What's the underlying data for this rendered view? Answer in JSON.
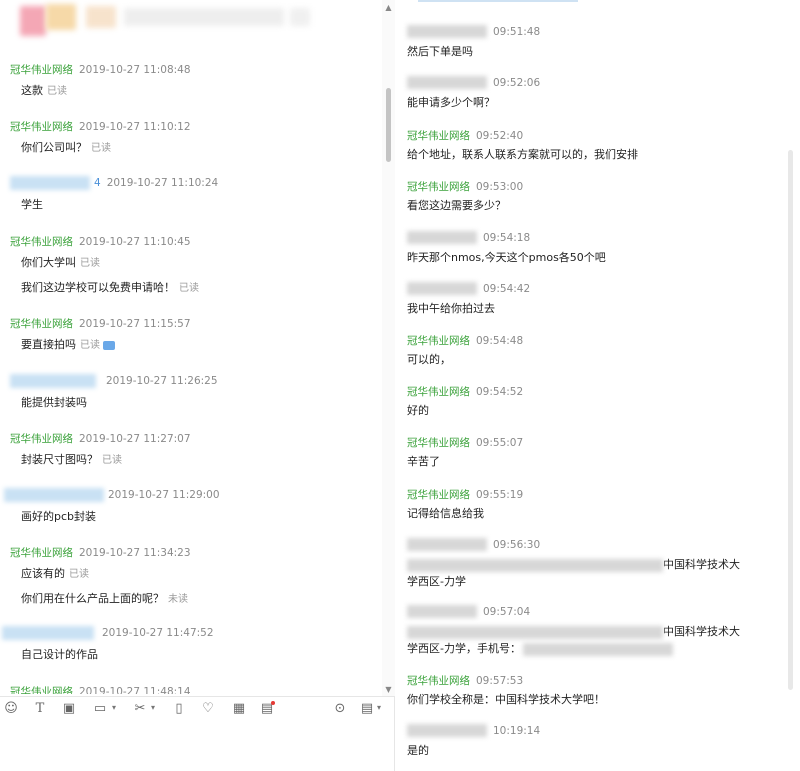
{
  "left": {
    "messages": [
      {
        "sender": "冠华伟业网络",
        "time": "2019-10-27 11:08:48",
        "lines": [
          {
            "text": "这款",
            "status": "已读"
          }
        ]
      },
      {
        "sender": "冠华伟业网络",
        "time": "2019-10-27 11:10:12",
        "lines": [
          {
            "text": "你们公司叫？",
            "status": "已读"
          }
        ]
      },
      {
        "sender": "4",
        "time": "2019-10-27 11:10:24",
        "lines": [
          {
            "text": "学生",
            "status": ""
          }
        ]
      },
      {
        "sender": "冠华伟业网络",
        "time": "2019-10-27 11:10:45",
        "lines": [
          {
            "text": "你们大学叫",
            "status": "已读"
          },
          {
            "text": "我们这边学校可以免费申请哈！",
            "status": "已读"
          }
        ]
      },
      {
        "sender": "冠华伟业网络",
        "time": "2019-10-27 11:15:57",
        "lines": [
          {
            "text": "要直接拍吗",
            "status": "已读"
          }
        ]
      },
      {
        "sender": "",
        "time": "2019-10-27 11:26:25",
        "lines": [
          {
            "text": "能提供封装吗",
            "status": ""
          }
        ]
      },
      {
        "sender": "冠华伟业网络",
        "time": "2019-10-27 11:27:07",
        "lines": [
          {
            "text": "封装尺寸图吗？",
            "status": "已读"
          }
        ]
      },
      {
        "sender": "",
        "time": "2019-10-27 11:29:00",
        "lines": [
          {
            "text": "画好的pcb封装",
            "status": ""
          }
        ]
      },
      {
        "sender": "冠华伟业网络",
        "time": "2019-10-27 11:34:23",
        "lines": [
          {
            "text": "应该有的",
            "status": "已读"
          },
          {
            "text": "你们用在什么产品上面的呢？",
            "status": "未读"
          }
        ]
      },
      {
        "sender": "",
        "time": "2019-10-27 11:47:52",
        "lines": [
          {
            "text": "自己设计的作品",
            "status": ""
          }
        ]
      },
      {
        "sender": "冠华伟业网络",
        "time": "2019-10-27 11:48:14",
        "lines": []
      }
    ]
  },
  "toolbar": {
    "icons": [
      "emoji-icon",
      "font-icon",
      "image-icon",
      "folder-icon",
      "scissors-icon",
      "vibrate-icon",
      "heart-icon",
      "calculator-icon",
      "clipboard-icon",
      "history-icon",
      "file-icon"
    ]
  },
  "right": {
    "messages": [
      {
        "sender": "",
        "time": "09:51:48",
        "text": "然后下单是吗"
      },
      {
        "sender": "",
        "time": "09:52:06",
        "text": "能申请多少个啊？"
      },
      {
        "sender": "冠华伟业网络",
        "time": "09:52:40",
        "text": "给个地址，联系人联系方案就可以的，我们安排"
      },
      {
        "sender": "冠华伟业网络",
        "time": "09:53:00",
        "text": "看您这边需要多少？"
      },
      {
        "sender": "向 524",
        "time": "09:54:18",
        "text": "昨天那个nmos,今天这个pmos各50个吧"
      },
      {
        "sender": "24",
        "time": "09:54:42",
        "text": "我中午给你拍过去"
      },
      {
        "sender": "冠华伟业网络",
        "time": "09:54:48",
        "text": "可以的，"
      },
      {
        "sender": "冠华伟业网络",
        "time": "09:54:52",
        "text": "好的"
      },
      {
        "sender": "冠华伟业网络",
        "time": "09:55:07",
        "text": "辛苦了"
      },
      {
        "sender": "冠华伟业网络",
        "time": "09:55:19",
        "text": "记得给信息给我"
      },
      {
        "sender": "向 4",
        "time": "09:56:30",
        "text": "中国科学技术大",
        "text2": "学西区-力学"
      },
      {
        "sender": "4",
        "time": "09:57:04",
        "text": "中国科学技术大",
        "text2": "学西区-力学，手机号："
      },
      {
        "sender": "冠华伟业网络",
        "time": "09:57:53",
        "text": "你们学校全称是：中国科学技术大学吧！"
      },
      {
        "sender": "",
        "time": "10:19:14",
        "text": "是的"
      }
    ]
  }
}
